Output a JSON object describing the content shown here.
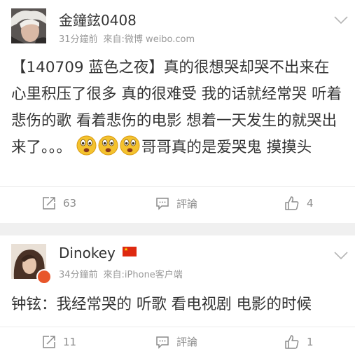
{
  "posts": [
    {
      "username": "金鐘鉉0408",
      "time": "31分鐘前",
      "source": "來自:微博 weibo.com",
      "content_text": "【140709 蓝色之夜】真的很想哭却哭不出来在心里积压了很多 真的很难受 我的话就经常哭 听着悲伤的歌 看着悲伤的电影 想着一天发生的就哭出来了。。。",
      "content_tail": "哥哥真的是爱哭鬼 摸摸头",
      "emojis": [
        "cry-emoji",
        "cry-emoji",
        "cry-emoji"
      ],
      "repost_count": "63",
      "comment_label": "評論",
      "like_count": "4"
    },
    {
      "username": "Dinokey",
      "flag_icon": "china-flag-icon",
      "time": "34分鐘前",
      "source": "來自:iPhone客户端",
      "content_text": "钟铉：我经常哭的 听歌 看电视剧 电影的时候",
      "repost_count": "11",
      "comment_label": "評論",
      "like_count": "1"
    }
  ],
  "icons": {
    "repost": "repost-icon",
    "comment": "comment-icon",
    "like": "thumbs-up-icon",
    "menu": "chevron-down-icon"
  },
  "colors": {
    "text": "#333333",
    "meta": "#999999",
    "action": "#8c8c8c",
    "separator": "#f0f0f0",
    "badge": "#e8562a"
  }
}
